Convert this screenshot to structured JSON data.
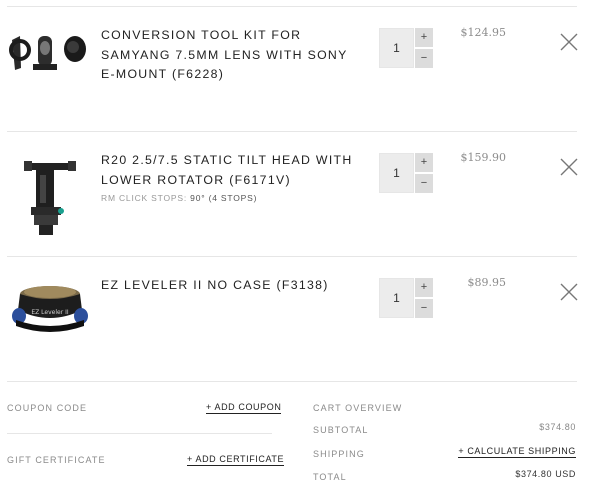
{
  "items": [
    {
      "name": "Conversion Tool Kit for Samyang 7.5mm Lens with Sony E-Mount (F6228)",
      "quantity": "1",
      "price": "$124.95",
      "image": "conversion-kit-image"
    },
    {
      "name": "R20 2.5/7.5 Static Tilt Head with Lower Rotator (F6171V)",
      "option_label": "RM CLICK STOPS:",
      "option_value": "90° (4 STOPS)",
      "quantity": "1",
      "price": "$159.90",
      "image": "tilt-head-image"
    },
    {
      "name": "EZ Leveler II No Case (F3138)",
      "quantity": "1",
      "price": "$89.95",
      "image": "ez-leveler-image",
      "image_text": "EZ Leveler II"
    }
  ],
  "qty_buttons": {
    "increase": "+",
    "decrease": "−"
  },
  "coupon": {
    "label": "COUPON CODE",
    "link": "+ ADD COUPON"
  },
  "gift": {
    "label": "GIFT CERTIFICATE",
    "link": "+ ADD CERTIFICATE"
  },
  "overview": {
    "title": "CART OVERVIEW",
    "subtotal_label": "SUBTOTAL",
    "subtotal_value": "$374.80",
    "shipping_label": "SHIPPING",
    "shipping_link": "+ CALCULATE SHIPPING",
    "total_label": "TOTAL",
    "total_value": "$374.80 USD"
  },
  "icons": {
    "remove": "close-icon"
  },
  "colors": {
    "qty_bg": "#ececec",
    "qty_btn_bg": "#dcdcdc",
    "price": "#8c8c8c",
    "divider": "#e6e6e6"
  }
}
